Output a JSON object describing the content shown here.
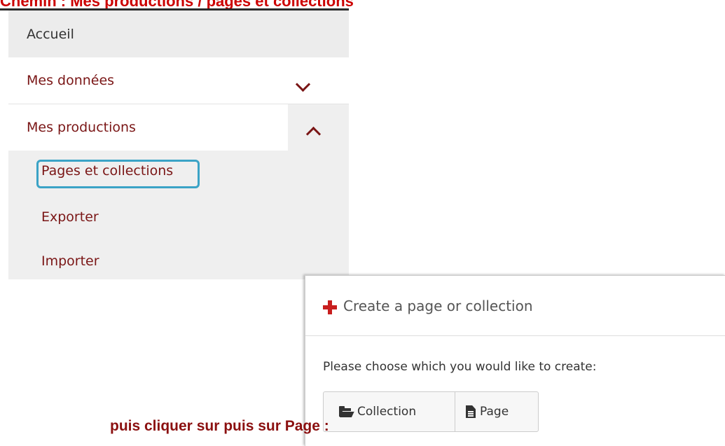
{
  "heading": "Chemin : Mes productions / pages et collections",
  "menu": {
    "home_label": "Accueil",
    "data_label": "Mes données",
    "productions_label": "Mes productions",
    "sub_items": [
      "Pages et collections",
      "Exporter",
      "Importer"
    ],
    "highlight_color": "#3ba3c6",
    "text_color": "#7a1616"
  },
  "panel": {
    "title": "Create a page or collection",
    "prompt": "Please choose which you would like to create:",
    "collection_label": "Collection",
    "page_label": "Page"
  },
  "footer_text": "puis cliquer sur puis sur Page :",
  "colors": {
    "heading": "#cc0000",
    "footer": "#8b1010",
    "plus_icon": "#c81e1e"
  }
}
